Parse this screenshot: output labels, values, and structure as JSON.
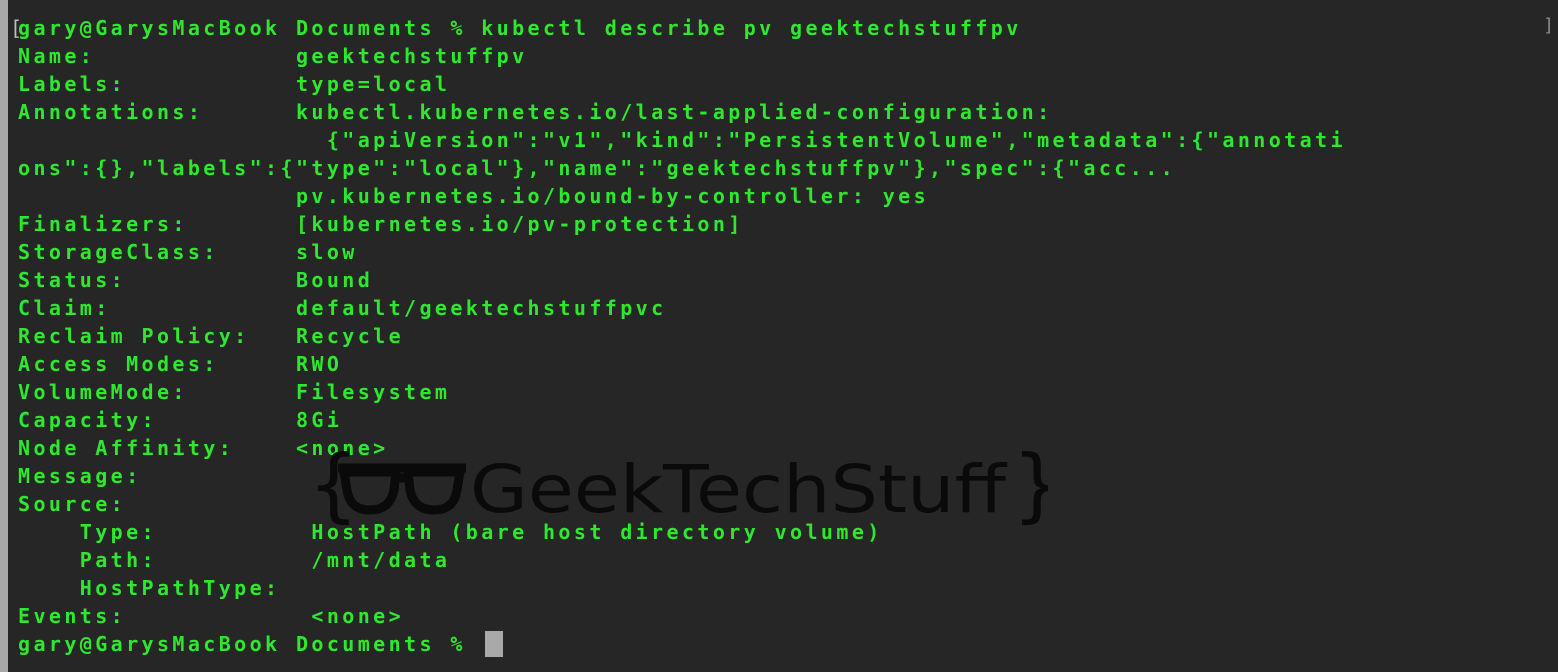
{
  "terminal": {
    "prompt_bracket": "[",
    "right_bracket": "]",
    "command_line": "gary@GarysMacBook Documents % kubectl describe pv geektechstuffpv",
    "output": [
      "Name:             geektechstuffpv",
      "Labels:           type=local",
      "Annotations:      kubectl.kubernetes.io/last-applied-configuration:",
      "                    {\"apiVersion\":\"v1\",\"kind\":\"PersistentVolume\",\"metadata\":{\"annotati",
      "ons\":{},\"labels\":{\"type\":\"local\"},\"name\":\"geektechstuffpv\"},\"spec\":{\"acc...",
      "                  pv.kubernetes.io/bound-by-controller: yes",
      "Finalizers:       [kubernetes.io/pv-protection]",
      "StorageClass:     slow",
      "Status:           Bound",
      "Claim:            default/geektechstuffpvc",
      "Reclaim Policy:   Recycle",
      "Access Modes:     RWO",
      "VolumeMode:       Filesystem",
      "Capacity:         8Gi",
      "Node Affinity:    <none>",
      "Message:",
      "Source:",
      "    Type:          HostPath (bare host directory volume)",
      "    Path:          /mnt/data",
      "    HostPathType:",
      "Events:            <none>"
    ],
    "final_prompt": "gary@GarysMacBook Documents % "
  },
  "watermark": {
    "text": "GeekTechStuff",
    "open_brace": "{",
    "close_brace": "}"
  },
  "colors": {
    "background": "#262626",
    "text": "#2ee82e",
    "cursor": "#a9a9a9",
    "watermark": "#0a0a0a"
  }
}
